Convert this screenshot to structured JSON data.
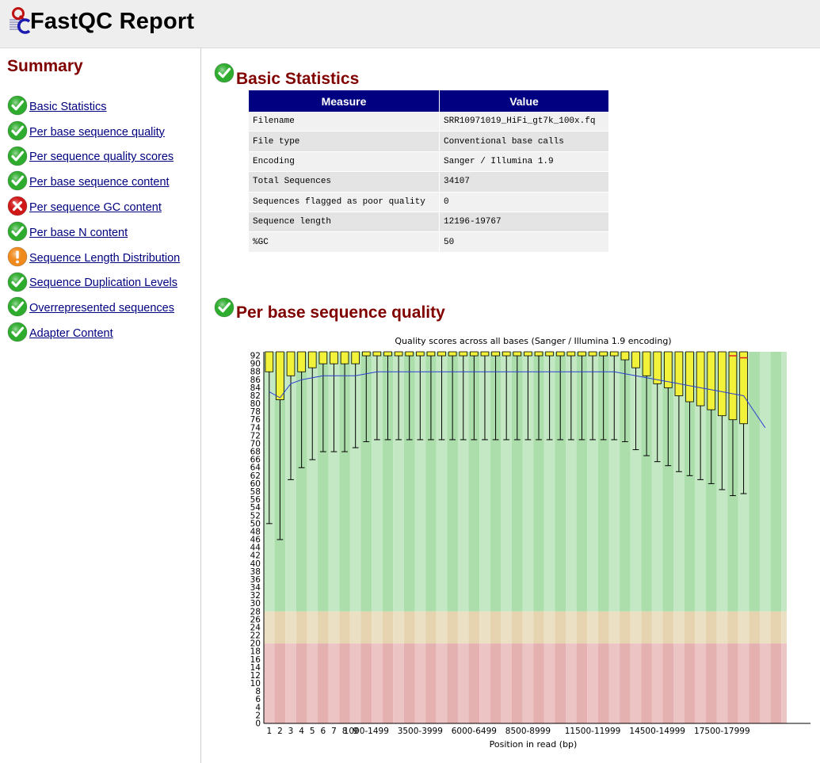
{
  "header": {
    "title": "FastQC Report"
  },
  "sidebar": {
    "title": "Summary",
    "items": [
      {
        "label": "Basic Statistics",
        "status": "pass"
      },
      {
        "label": "Per base sequence quality",
        "status": "pass"
      },
      {
        "label": "Per sequence quality scores",
        "status": "pass"
      },
      {
        "label": "Per base sequence content",
        "status": "pass"
      },
      {
        "label": "Per sequence GC content",
        "status": "fail"
      },
      {
        "label": "Per base N content",
        "status": "pass"
      },
      {
        "label": "Sequence Length Distribution",
        "status": "warn"
      },
      {
        "label": "Sequence Duplication Levels",
        "status": "pass"
      },
      {
        "label": "Overrepresented sequences",
        "status": "pass"
      },
      {
        "label": "Adapter Content",
        "status": "pass"
      }
    ]
  },
  "colors": {
    "pass": "#2eac2e",
    "fail": "#d01818",
    "warn": "#f08a1c",
    "title": "#800000",
    "link": "#000080",
    "table_header": "#000080"
  },
  "basic_stats": {
    "title": "Basic Statistics",
    "headers": [
      "Measure",
      "Value"
    ],
    "rows": [
      [
        "Filename",
        "SRR10971019_HiFi_gt7k_100x.fq"
      ],
      [
        "File type",
        "Conventional base calls"
      ],
      [
        "Encoding",
        "Sanger / Illumina 1.9"
      ],
      [
        "Total Sequences",
        "34107"
      ],
      [
        "Sequences flagged as poor quality",
        "0"
      ],
      [
        "Sequence length",
        "12196-19767"
      ],
      [
        "%GC",
        "50"
      ]
    ]
  },
  "quality_section": {
    "title": "Per base sequence quality"
  },
  "chart_data": {
    "type": "box",
    "title": "Quality scores across all bases (Sanger / Illumina 1.9 encoding)",
    "xlabel": "Position in read (bp)",
    "ylabel": "",
    "ylim": [
      0,
      93
    ],
    "yticks": [
      0,
      2,
      4,
      6,
      8,
      10,
      12,
      14,
      16,
      18,
      20,
      22,
      24,
      26,
      28,
      30,
      32,
      34,
      36,
      38,
      40,
      42,
      44,
      46,
      48,
      50,
      52,
      54,
      56,
      58,
      60,
      62,
      64,
      66,
      68,
      70,
      72,
      74,
      76,
      78,
      80,
      82,
      84,
      86,
      88,
      90,
      92
    ],
    "xtick_labels": [
      "1",
      "2",
      "3",
      "4",
      "5",
      "6",
      "7",
      "8",
      "9",
      "1000-1499",
      "3500-3999",
      "6000-6499",
      "8500-8999",
      "11500-11999",
      "14500-14999",
      "17500-17999"
    ],
    "xtick_positions": [
      1,
      2,
      3,
      4,
      5,
      6,
      7,
      8,
      9,
      10,
      15,
      20,
      25,
      31,
      37,
      43
    ],
    "bands": [
      {
        "from": 28,
        "to": 93,
        "color": "green"
      },
      {
        "from": 20,
        "to": 28,
        "color": "orange"
      },
      {
        "from": 0,
        "to": 20,
        "color": "red"
      }
    ],
    "boxes": [
      {
        "pos": 1,
        "q1": 88,
        "median": 93,
        "q3": 93,
        "low": 50,
        "high": 93
      },
      {
        "pos": 2,
        "q1": 81,
        "median": 93,
        "q3": 93,
        "low": 46,
        "high": 93
      },
      {
        "pos": 3,
        "q1": 87,
        "median": 93,
        "q3": 93,
        "low": 61,
        "high": 93
      },
      {
        "pos": 4,
        "q1": 88,
        "median": 93,
        "q3": 93,
        "low": 64,
        "high": 93
      },
      {
        "pos": 5,
        "q1": 89,
        "median": 93,
        "q3": 93,
        "low": 66,
        "high": 93
      },
      {
        "pos": 6,
        "q1": 90,
        "median": 93,
        "q3": 93,
        "low": 68,
        "high": 93
      },
      {
        "pos": 7,
        "q1": 90,
        "median": 93,
        "q3": 93,
        "low": 68,
        "high": 93
      },
      {
        "pos": 8,
        "q1": 90,
        "median": 93,
        "q3": 93,
        "low": 68,
        "high": 93
      },
      {
        "pos": 9,
        "q1": 90,
        "median": 93,
        "q3": 93,
        "low": 69,
        "high": 93
      },
      {
        "pos": 10,
        "q1": 92,
        "median": 93,
        "q3": 93,
        "low": 70.5,
        "high": 93
      },
      {
        "pos": 11,
        "q1": 92,
        "median": 93,
        "q3": 93,
        "low": 71,
        "high": 93
      },
      {
        "pos": 12,
        "q1": 92,
        "median": 93,
        "q3": 93,
        "low": 71,
        "high": 93
      },
      {
        "pos": 13,
        "q1": 92,
        "median": 93,
        "q3": 93,
        "low": 71,
        "high": 93
      },
      {
        "pos": 14,
        "q1": 92,
        "median": 93,
        "q3": 93,
        "low": 71,
        "high": 93
      },
      {
        "pos": 15,
        "q1": 92,
        "median": 93,
        "q3": 93,
        "low": 71,
        "high": 93
      },
      {
        "pos": 16,
        "q1": 92,
        "median": 93,
        "q3": 93,
        "low": 71,
        "high": 93
      },
      {
        "pos": 17,
        "q1": 92,
        "median": 93,
        "q3": 93,
        "low": 71,
        "high": 93
      },
      {
        "pos": 18,
        "q1": 92,
        "median": 93,
        "q3": 93,
        "low": 71,
        "high": 93
      },
      {
        "pos": 19,
        "q1": 92,
        "median": 93,
        "q3": 93,
        "low": 71,
        "high": 93
      },
      {
        "pos": 20,
        "q1": 92,
        "median": 93,
        "q3": 93,
        "low": 71,
        "high": 93
      },
      {
        "pos": 21,
        "q1": 92,
        "median": 93,
        "q3": 93,
        "low": 71,
        "high": 93
      },
      {
        "pos": 22,
        "q1": 92,
        "median": 93,
        "q3": 93,
        "low": 71,
        "high": 93
      },
      {
        "pos": 23,
        "q1": 92,
        "median": 93,
        "q3": 93,
        "low": 71,
        "high": 93
      },
      {
        "pos": 24,
        "q1": 92,
        "median": 93,
        "q3": 93,
        "low": 71,
        "high": 93
      },
      {
        "pos": 25,
        "q1": 92,
        "median": 93,
        "q3": 93,
        "low": 71,
        "high": 93
      },
      {
        "pos": 26,
        "q1": 92,
        "median": 93,
        "q3": 93,
        "low": 71,
        "high": 93
      },
      {
        "pos": 27,
        "q1": 92,
        "median": 93,
        "q3": 93,
        "low": 71,
        "high": 93
      },
      {
        "pos": 28,
        "q1": 92,
        "median": 93,
        "q3": 93,
        "low": 71,
        "high": 93
      },
      {
        "pos": 29,
        "q1": 92,
        "median": 93,
        "q3": 93,
        "low": 71,
        "high": 93
      },
      {
        "pos": 30,
        "q1": 92,
        "median": 93,
        "q3": 93,
        "low": 71,
        "high": 93
      },
      {
        "pos": 31,
        "q1": 92,
        "median": 93,
        "q3": 93,
        "low": 71,
        "high": 93
      },
      {
        "pos": 32,
        "q1": 92,
        "median": 93,
        "q3": 93,
        "low": 71,
        "high": 93
      },
      {
        "pos": 33,
        "q1": 92,
        "median": 93,
        "q3": 93,
        "low": 71,
        "high": 93
      },
      {
        "pos": 34,
        "q1": 91,
        "median": 93,
        "q3": 93,
        "low": 70.5,
        "high": 93
      },
      {
        "pos": 35,
        "q1": 89,
        "median": 93,
        "q3": 93,
        "low": 68.5,
        "high": 93
      },
      {
        "pos": 36,
        "q1": 87,
        "median": 93,
        "q3": 93,
        "low": 67,
        "high": 93
      },
      {
        "pos": 37,
        "q1": 85,
        "median": 93,
        "q3": 93,
        "low": 65.5,
        "high": 93
      },
      {
        "pos": 38,
        "q1": 84,
        "median": 93,
        "q3": 93,
        "low": 64.5,
        "high": 93
      },
      {
        "pos": 39,
        "q1": 82,
        "median": 93,
        "q3": 93,
        "low": 63,
        "high": 93
      },
      {
        "pos": 40,
        "q1": 80.5,
        "median": 93,
        "q3": 93,
        "low": 62,
        "high": 93
      },
      {
        "pos": 41,
        "q1": 79.5,
        "median": 93,
        "q3": 93,
        "low": 61,
        "high": 93
      },
      {
        "pos": 42,
        "q1": 78.5,
        "median": 93,
        "q3": 93,
        "low": 60,
        "high": 93
      },
      {
        "pos": 43,
        "q1": 77,
        "median": 93,
        "q3": 93,
        "low": 58.5,
        "high": 93
      },
      {
        "pos": 44,
        "q1": 76,
        "median": 92,
        "q3": 93,
        "low": 57,
        "high": 93
      },
      {
        "pos": 45,
        "q1": 75,
        "median": 91.5,
        "q3": 93,
        "low": 57.5,
        "high": 93
      }
    ],
    "mean_line": [
      [
        1,
        83
      ],
      [
        2,
        81.5
      ],
      [
        3,
        85
      ],
      [
        4,
        86
      ],
      [
        5,
        86.5
      ],
      [
        6,
        87
      ],
      [
        7,
        87
      ],
      [
        8,
        87
      ],
      [
        9,
        87
      ],
      [
        10,
        87.5
      ],
      [
        11,
        88
      ],
      [
        12,
        88
      ],
      [
        13,
        88
      ],
      [
        14,
        88
      ],
      [
        15,
        88
      ],
      [
        16,
        88
      ],
      [
        17,
        88
      ],
      [
        18,
        88
      ],
      [
        19,
        88
      ],
      [
        20,
        88
      ],
      [
        21,
        88
      ],
      [
        22,
        88
      ],
      [
        23,
        88
      ],
      [
        24,
        88
      ],
      [
        25,
        88
      ],
      [
        26,
        88
      ],
      [
        27,
        88
      ],
      [
        28,
        88
      ],
      [
        29,
        88
      ],
      [
        30,
        88
      ],
      [
        31,
        88
      ],
      [
        32,
        88
      ],
      [
        33,
        88
      ],
      [
        34,
        87.5
      ],
      [
        35,
        87
      ],
      [
        36,
        86.5
      ],
      [
        37,
        86
      ],
      [
        38,
        85.5
      ],
      [
        39,
        85
      ],
      [
        40,
        84.5
      ],
      [
        41,
        84
      ],
      [
        42,
        83.5
      ],
      [
        43,
        83
      ],
      [
        44,
        82.5
      ],
      [
        45,
        82
      ],
      [
        46,
        78
      ],
      [
        47,
        74
      ]
    ]
  }
}
